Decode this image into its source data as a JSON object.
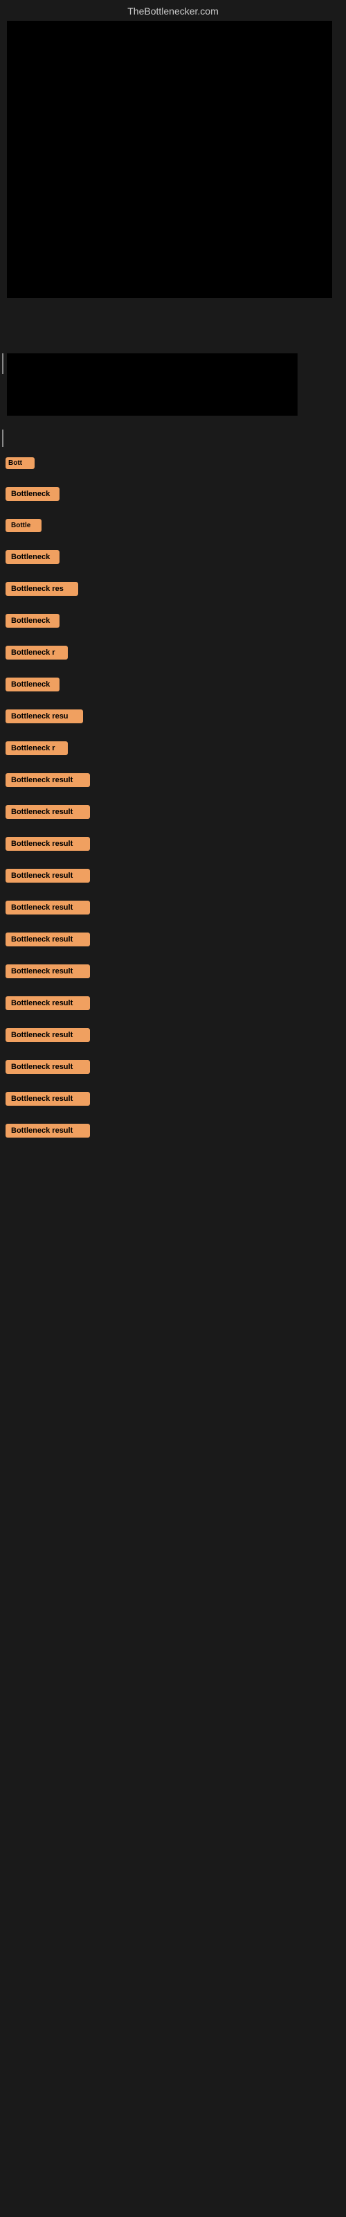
{
  "site": {
    "title": "TheBottlenecker.com"
  },
  "results": [
    {
      "id": 1,
      "label": "Bott",
      "width": 42
    },
    {
      "id": 2,
      "label": "Bottleneck",
      "width": 78
    },
    {
      "id": 3,
      "label": "Bottle",
      "width": 52
    },
    {
      "id": 4,
      "label": "Bottleneck",
      "width": 78
    },
    {
      "id": 5,
      "label": "Bottleneck res",
      "width": 105
    },
    {
      "id": 6,
      "label": "Bottleneck",
      "width": 78
    },
    {
      "id": 7,
      "label": "Bottleneck r",
      "width": 88
    },
    {
      "id": 8,
      "label": "Bottleneck",
      "width": 78
    },
    {
      "id": 9,
      "label": "Bottleneck resu",
      "width": 110
    },
    {
      "id": 10,
      "label": "Bottleneck r",
      "width": 88
    },
    {
      "id": 11,
      "label": "Bottleneck result",
      "width": 120
    },
    {
      "id": 12,
      "label": "Bottleneck result",
      "width": 120
    },
    {
      "id": 13,
      "label": "Bottleneck result",
      "width": 120
    },
    {
      "id": 14,
      "label": "Bottleneck result",
      "width": 120
    },
    {
      "id": 15,
      "label": "Bottleneck result",
      "width": 120
    },
    {
      "id": 16,
      "label": "Bottleneck result",
      "width": 120
    },
    {
      "id": 17,
      "label": "Bottleneck result",
      "width": 120
    },
    {
      "id": 18,
      "label": "Bottleneck result",
      "width": 120
    },
    {
      "id": 19,
      "label": "Bottleneck result",
      "width": 120
    },
    {
      "id": 20,
      "label": "Bottleneck result",
      "width": 120
    },
    {
      "id": 21,
      "label": "Bottleneck result",
      "width": 120
    },
    {
      "id": 22,
      "label": "Bottleneck result",
      "width": 120
    }
  ],
  "colors": {
    "background": "#1a1a1a",
    "badge_bg": "#f0a060",
    "badge_text": "#000000",
    "title_color": "#cccccc"
  }
}
